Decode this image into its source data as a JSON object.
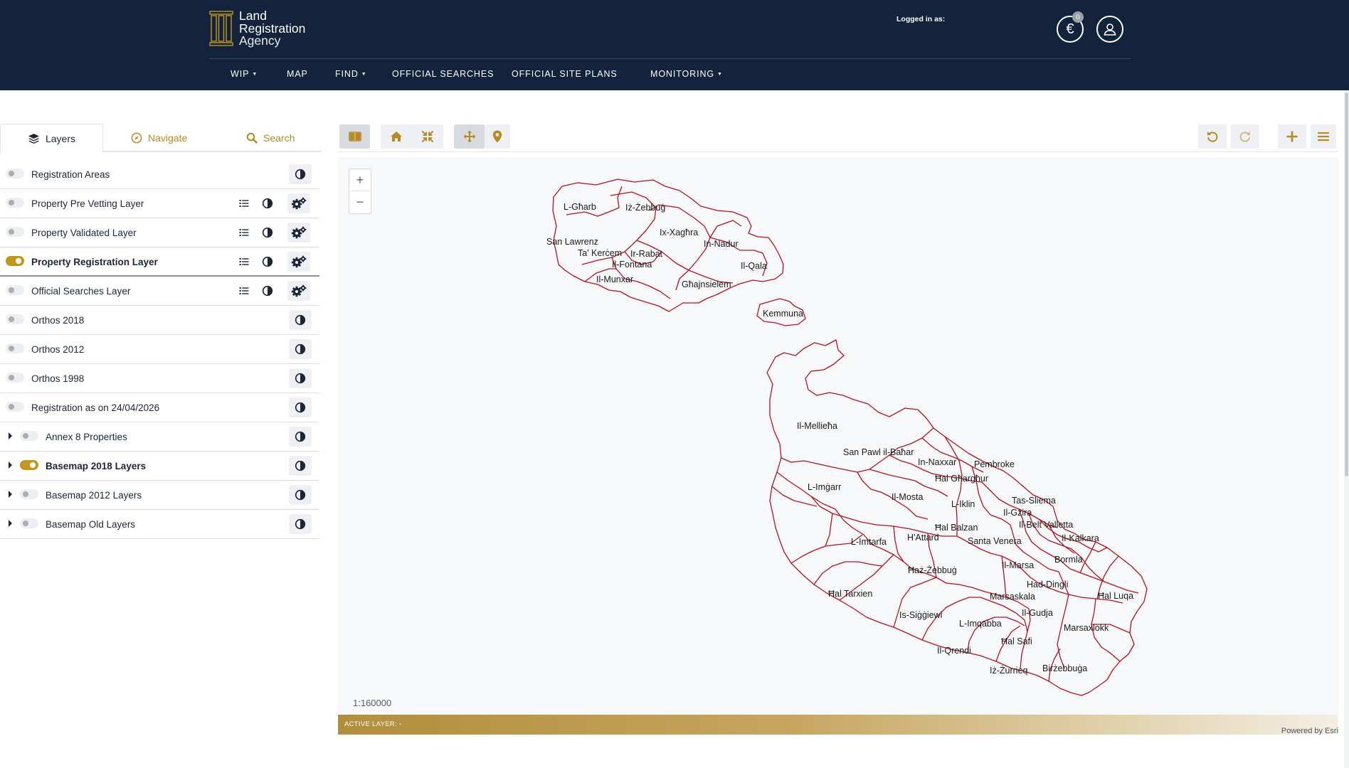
{
  "brand": {
    "line1": "Land",
    "line2": "Registration",
    "line3": "Agency"
  },
  "header": {
    "logged_in_label": "Logged in as:",
    "basket_count": "0",
    "basket_symbol": "€"
  },
  "nav": [
    {
      "label": "WIP",
      "has_dropdown": true
    },
    {
      "label": "MAP",
      "has_dropdown": false
    },
    {
      "label": "FIND",
      "has_dropdown": true
    },
    {
      "label": "OFFICIAL SEARCHES",
      "has_dropdown": false
    },
    {
      "label": "OFFICIAL SITE PLANS",
      "has_dropdown": false
    },
    {
      "label": "MONITORING",
      "has_dropdown": true
    }
  ],
  "tabs": [
    {
      "label": "Layers",
      "icon": "layers-icon",
      "active": true
    },
    {
      "label": "Navigate",
      "icon": "compass-icon",
      "active": false
    },
    {
      "label": "Search",
      "icon": "search-icon",
      "active": false
    }
  ],
  "layers": [
    {
      "label": "Registration Areas",
      "on": false,
      "expandable": false,
      "legend": false,
      "settings": false
    },
    {
      "label": "Property Pre Vetting Layer",
      "on": false,
      "expandable": false,
      "legend": true,
      "settings": true
    },
    {
      "label": "Property Validated Layer",
      "on": false,
      "expandable": false,
      "legend": true,
      "settings": true
    },
    {
      "label": "Property Registration Layer",
      "on": true,
      "expandable": false,
      "legend": true,
      "settings": true
    },
    {
      "label": "Official Searches Layer",
      "on": false,
      "expandable": false,
      "legend": true,
      "settings": true
    },
    {
      "label": "Orthos 2018",
      "on": false,
      "expandable": false,
      "legend": false,
      "settings": false
    },
    {
      "label": "Orthos 2012",
      "on": false,
      "expandable": false,
      "legend": false,
      "settings": false
    },
    {
      "label": "Orthos 1998",
      "on": false,
      "expandable": false,
      "legend": false,
      "settings": false
    },
    {
      "label": "Registration as on 24/04/2026",
      "on": false,
      "expandable": false,
      "legend": false,
      "settings": false
    },
    {
      "label": "Annex 8 Properties",
      "on": false,
      "expandable": true,
      "legend": false,
      "settings": false
    },
    {
      "label": "Basemap 2018 Layers",
      "on": true,
      "expandable": true,
      "legend": false,
      "settings": false
    },
    {
      "label": "Basemap 2012 Layers",
      "on": false,
      "expandable": true,
      "legend": false,
      "settings": false
    },
    {
      "label": "Basemap Old Layers",
      "on": false,
      "expandable": true,
      "legend": false,
      "settings": false
    }
  ],
  "map": {
    "scale": "1:160000",
    "active_layer": "ACTIVE LAYER: -",
    "attribution": "Powered by Esri",
    "boundary_color": "#b3121f",
    "zoom_in": "+",
    "zoom_out": "−",
    "localities": [
      "L-Għarb",
      "Iż-Żebbuġ",
      "Ix-Xagħra",
      "In-Nadur",
      "San Lawrenz",
      "Ta' Kerċem",
      "Ir-Rabat",
      "Il-Fontana",
      "Il-Qala",
      "Il-Munxar",
      "Għajnsielem",
      "Kemmuna",
      "Il-Mellieħa",
      "San Pawl il-Baħar",
      "In-Naxxar",
      "Pembroke",
      "Ħal Għargħur",
      "L-Imġarr",
      "Il-Mosta",
      "L-Iklin",
      "Tas-Sliema",
      "Il-Gżira",
      "Ħal Balzan",
      "Il-Belt Valletta",
      "L-Imtarfa",
      "H'Attard",
      "Santa Venera",
      "Il-Kalkara",
      "Il-Marsa",
      "Bormla",
      "Ħaż-Żebbuġ",
      "Ħal Tarxien",
      "Had-Dingli",
      "Ħal Luqa",
      "Marsaskala",
      "Il-Gudja",
      "Is-Siġġiewi",
      "L-Imqabba",
      "Marsaxlokk",
      "Ħal Safi",
      "Il-Qrendi",
      "Iż-Żurrieq",
      "Birżebbuġa"
    ]
  }
}
